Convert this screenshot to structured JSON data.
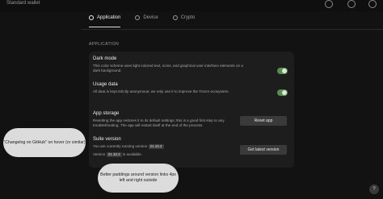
{
  "header": {
    "wallet_name": "Standard wallet",
    "icons": [
      "notifications-icon",
      "settings-icon",
      "device-icon"
    ]
  },
  "tabs": [
    {
      "label": "Application",
      "icon": "settings-icon",
      "active": true
    },
    {
      "label": "Device",
      "icon": "device-icon",
      "active": false
    },
    {
      "label": "Crypto",
      "icon": "crypto-icon",
      "active": false
    }
  ],
  "section_label": "APPLICATION",
  "settings": {
    "dark_mode": {
      "title": "Dark mode",
      "description": "This color scheme uses light-colored text, icons, and graphical user interface elements on a dark background.",
      "enabled": true
    },
    "usage_data": {
      "title": "Usage data",
      "description": "All data is kept strictly anonymous; we only use it to improve the Trezor ecosystem.",
      "enabled": true
    },
    "app_storage": {
      "title": "App storage",
      "description": "Resetting the app restores it to its default settings; this is a good first step to any troubleshooting. The app will restart itself at the end of the process.",
      "button_label": "Reset app"
    },
    "suite_version": {
      "title": "Suite version",
      "running_prefix": "You are currently running version",
      "running_version": "21.10.2",
      "available_prefix": "Version",
      "available_version": "21.10.2",
      "available_suffix": "is available.",
      "button_label": "Get latest version"
    }
  },
  "annotations": {
    "note1": "\"Changelog on GitHub\" on hover (or similar)",
    "note2": "Better paddings around version links 4px left and right outside"
  },
  "help_button": "?",
  "colors": {
    "toggle_on": "#5b8b53",
    "background": "#121212",
    "card": "#1d1d1d"
  }
}
